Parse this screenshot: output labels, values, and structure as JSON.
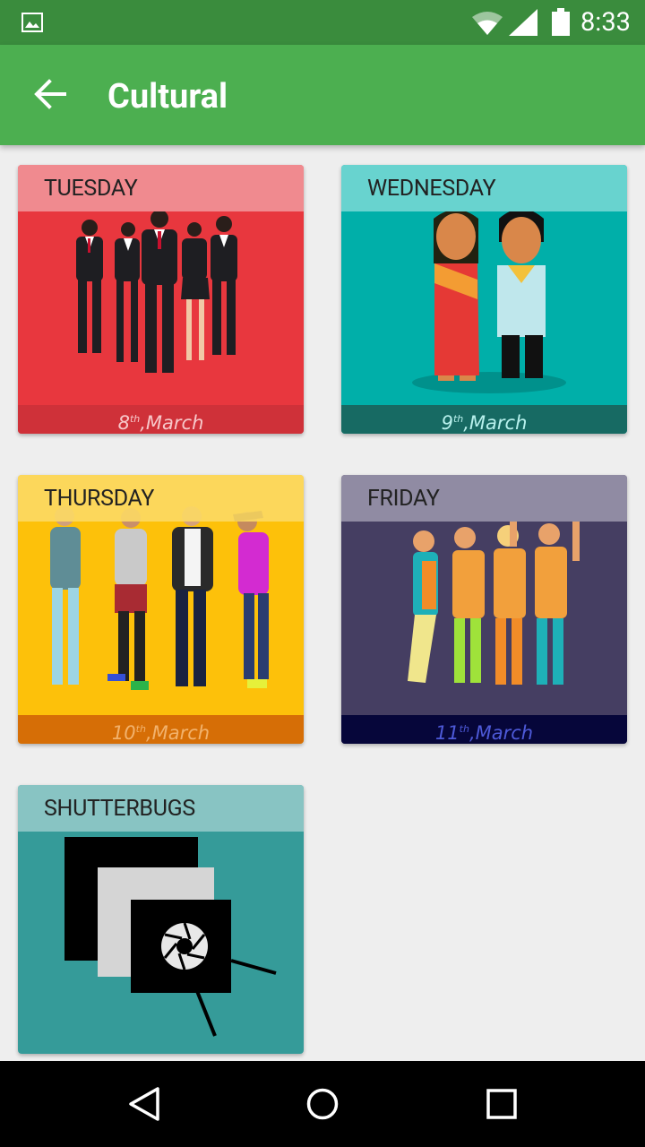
{
  "status_bar": {
    "time": "8:33"
  },
  "app_bar": {
    "title": "Cultural"
  },
  "cards": [
    {
      "label": "TUESDAY",
      "date_day": "8",
      "date_suffix": "th",
      "date_month": ",March"
    },
    {
      "label": "WEDNESDAY",
      "date_day": "9",
      "date_suffix": "th",
      "date_month": ",March"
    },
    {
      "label": "THURSDAY",
      "date_day": "10",
      "date_suffix": "th",
      "date_month": ",March"
    },
    {
      "label": "FRIDAY",
      "date_day": "11",
      "date_suffix": "th",
      "date_month": ",March"
    },
    {
      "label": "SHUTTERBUGS"
    }
  ],
  "colors": {
    "status_bar": "#3a8c3d",
    "app_bar": "#4caf50",
    "tuesday": "#e8373e",
    "wednesday": "#00afa9",
    "thursday": "#fdc10a",
    "friday": "#453e62",
    "shutterbugs": "#359b99"
  },
  "icons": {
    "status": [
      "image-icon",
      "wifi-icon",
      "signal-icon",
      "battery-icon"
    ],
    "app_bar": "back-arrow-icon",
    "nav": [
      "back-nav-icon",
      "home-nav-icon",
      "recents-nav-icon"
    ]
  }
}
